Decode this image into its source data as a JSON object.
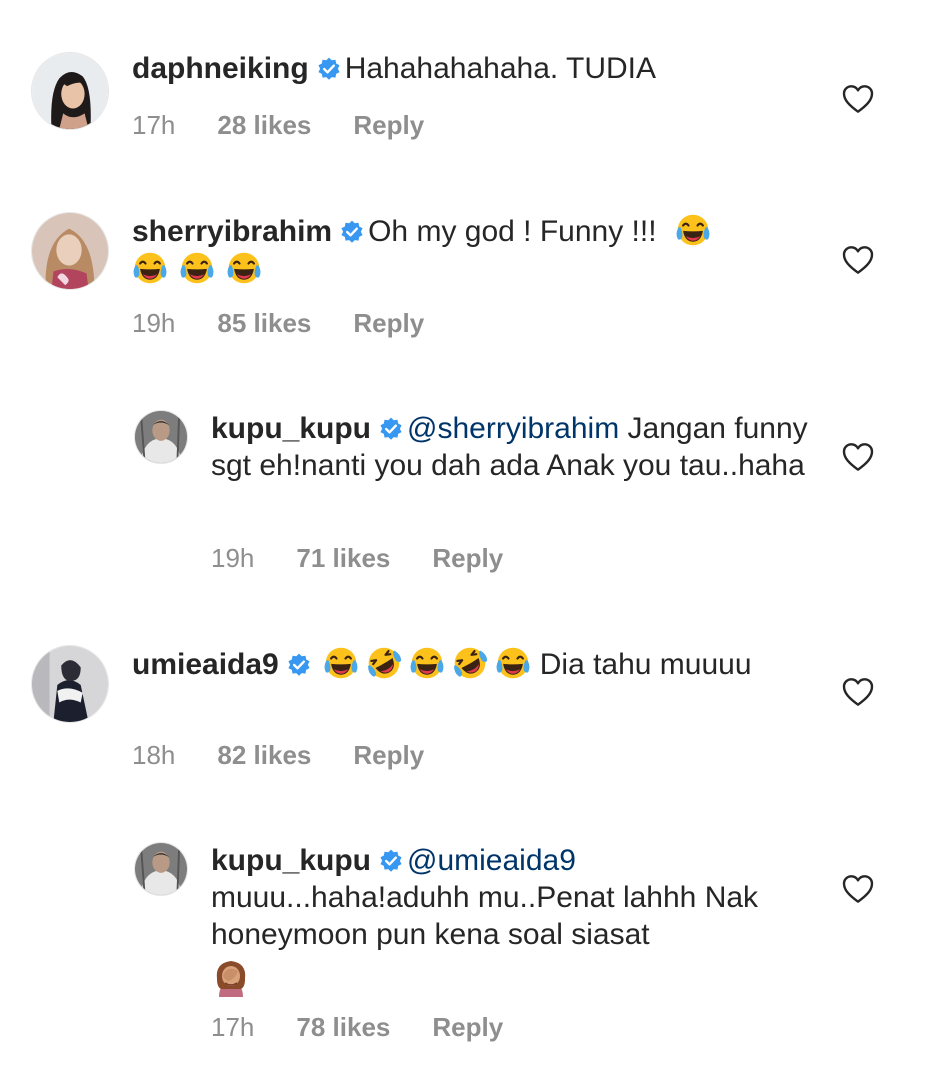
{
  "comments": [
    {
      "username": "daphneiking",
      "text": "Hahahahahaha. TUDIA",
      "time": "17h",
      "likes": "28 likes",
      "reply": "Reply"
    },
    {
      "username": "sherryibrahim",
      "text": "Oh my god ! Funny !!!",
      "time": "19h",
      "likes": "85 likes",
      "reply": "Reply"
    },
    {
      "username": "kupu_kupu",
      "mention": "@sherryibrahim",
      "text": "Jangan funny sgt eh!nanti you dah ada Anak you tau..haha",
      "time": "19h",
      "likes": "71 likes",
      "reply": "Reply"
    },
    {
      "username": "umieaida9",
      "text": "Dia tahu muuuu",
      "time": "18h",
      "likes": "82 likes",
      "reply": "Reply"
    },
    {
      "username": "kupu_kupu",
      "mention": "@umieaida9",
      "text": "muuu...haha!aduhh mu..Penat lahhh Nak honeymoon pun kena soal siasat",
      "time": "17h",
      "likes": "78 likes",
      "reply": "Reply"
    }
  ],
  "icons": {
    "verified": "verified-badge-icon",
    "like": "heart-outline-icon",
    "laugh": "face-with-tears-of-joy-emoji",
    "rofl": "rolling-on-floor-laughing-emoji",
    "facepalm": "person-facepalming-emoji"
  },
  "colors": {
    "verified": "#3897f0",
    "text": "#262626",
    "meta": "#8e8e8e",
    "mention": "#003569"
  }
}
